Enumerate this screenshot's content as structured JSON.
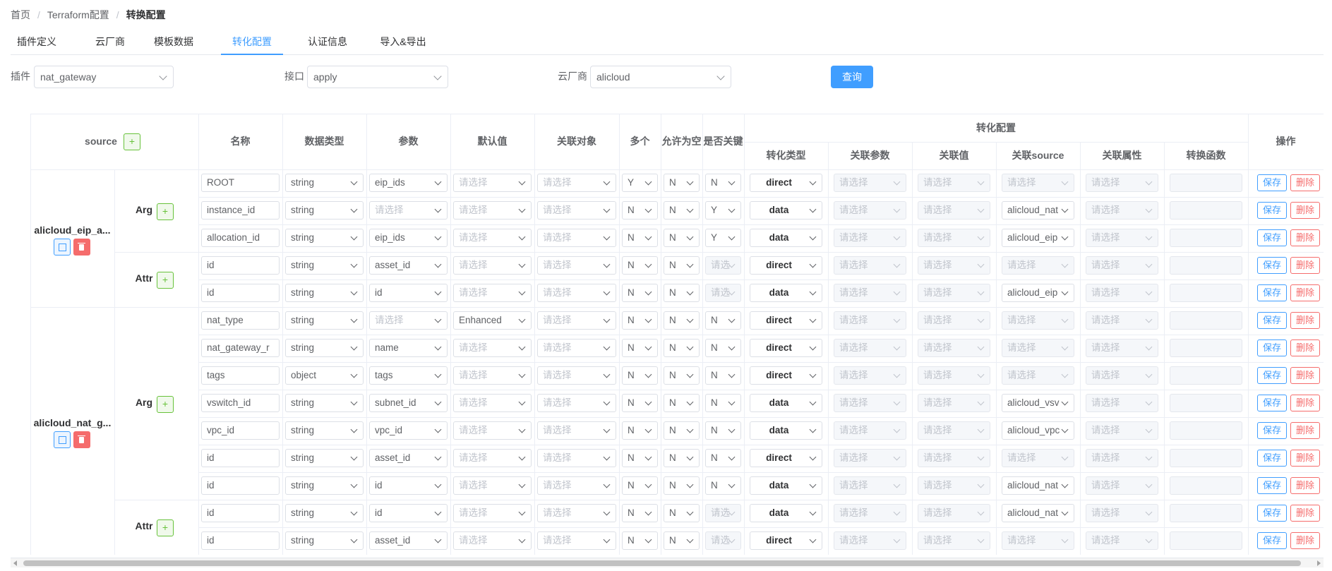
{
  "breadcrumb": [
    "首页",
    "Terraform配置",
    "转换配置"
  ],
  "tabs": [
    "插件定义",
    "云厂商",
    "模板数据",
    "转化配置",
    "认证信息",
    "导入&导出"
  ],
  "active_tab": 3,
  "filters": {
    "plugin_label": "插件",
    "plugin_value": "nat_gateway",
    "api_label": "接口",
    "api_value": "apply",
    "vendor_label": "云厂商",
    "vendor_value": "alicloud",
    "query_button": "查询"
  },
  "table": {
    "header_source": "source",
    "header_add": "+",
    "headers": [
      "名称",
      "数据类型",
      "参数",
      "默认值",
      "关联对象",
      "多个",
      "允许为空",
      "是否关键"
    ],
    "header_group": "转化配置",
    "sub_headers": [
      "转化类型",
      "关联参数",
      "关联值",
      "关联source",
      "关联属性",
      "转换函数"
    ],
    "header_ops": "操作",
    "placeholder": "请选择",
    "save_label": "保存",
    "delete_label": "删除",
    "resources": [
      {
        "name": "alicloud_eip_a...",
        "groups": [
          {
            "name": "Arg",
            "rows": [
              {
                "name": "ROOT",
                "dtype": "string",
                "param": "eip_ids",
                "def": "",
                "obj": "",
                "multi": "Y",
                "nullable": "N",
                "key": "N",
                "conv": "direct",
                "source": ""
              },
              {
                "name": "instance_id",
                "dtype": "string",
                "param": "",
                "def": "",
                "obj": "",
                "multi": "N",
                "nullable": "N",
                "key": "Y",
                "conv": "data",
                "source": "alicloud_nat"
              },
              {
                "name": "allocation_id",
                "dtype": "string",
                "param": "eip_ids",
                "def": "",
                "obj": "",
                "multi": "N",
                "nullable": "N",
                "key": "Y",
                "conv": "data",
                "source": "alicloud_eip"
              }
            ]
          },
          {
            "name": "Attr",
            "rows": [
              {
                "name": "id",
                "dtype": "string",
                "param": "asset_id",
                "def": "",
                "obj": "",
                "multi": "N",
                "nullable": "N",
                "key": "请选",
                "conv": "direct",
                "source": ""
              },
              {
                "name": "id",
                "dtype": "string",
                "param": "id",
                "def": "",
                "obj": "",
                "multi": "N",
                "nullable": "N",
                "key": "请选",
                "conv": "data",
                "source": "alicloud_eip"
              }
            ]
          }
        ]
      },
      {
        "name": "alicloud_nat_g...",
        "groups": [
          {
            "name": "Arg",
            "rows": [
              {
                "name": "nat_type",
                "dtype": "string",
                "param": "",
                "def": "Enhanced",
                "obj": "",
                "multi": "N",
                "nullable": "N",
                "key": "N",
                "conv": "direct",
                "source": ""
              },
              {
                "name": "nat_gateway_r",
                "dtype": "string",
                "param": "name",
                "def": "",
                "obj": "",
                "multi": "N",
                "nullable": "N",
                "key": "N",
                "conv": "direct",
                "source": ""
              },
              {
                "name": "tags",
                "dtype": "object",
                "param": "tags",
                "def": "",
                "obj": "",
                "multi": "N",
                "nullable": "N",
                "key": "N",
                "conv": "direct",
                "source": ""
              },
              {
                "name": "vswitch_id",
                "dtype": "string",
                "param": "subnet_id",
                "def": "",
                "obj": "",
                "multi": "N",
                "nullable": "N",
                "key": "N",
                "conv": "data",
                "source": "alicloud_vsv"
              },
              {
                "name": "vpc_id",
                "dtype": "string",
                "param": "vpc_id",
                "def": "",
                "obj": "",
                "multi": "N",
                "nullable": "N",
                "key": "N",
                "conv": "data",
                "source": "alicloud_vpc"
              },
              {
                "name": "id",
                "dtype": "string",
                "param": "asset_id",
                "def": "",
                "obj": "",
                "multi": "N",
                "nullable": "N",
                "key": "N",
                "conv": "direct",
                "source": ""
              },
              {
                "name": "id",
                "dtype": "string",
                "param": "id",
                "def": "",
                "obj": "",
                "multi": "N",
                "nullable": "N",
                "key": "N",
                "conv": "data",
                "source": "alicloud_nat"
              }
            ]
          },
          {
            "name": "Attr",
            "rows": [
              {
                "name": "id",
                "dtype": "string",
                "param": "id",
                "def": "",
                "obj": "",
                "multi": "N",
                "nullable": "N",
                "key": "请选",
                "conv": "data",
                "source": "alicloud_nat"
              },
              {
                "name": "id",
                "dtype": "string",
                "param": "asset_id",
                "def": "",
                "obj": "",
                "multi": "N",
                "nullable": "N",
                "key": "请选",
                "conv": "direct",
                "source": ""
              }
            ]
          }
        ]
      }
    ]
  }
}
